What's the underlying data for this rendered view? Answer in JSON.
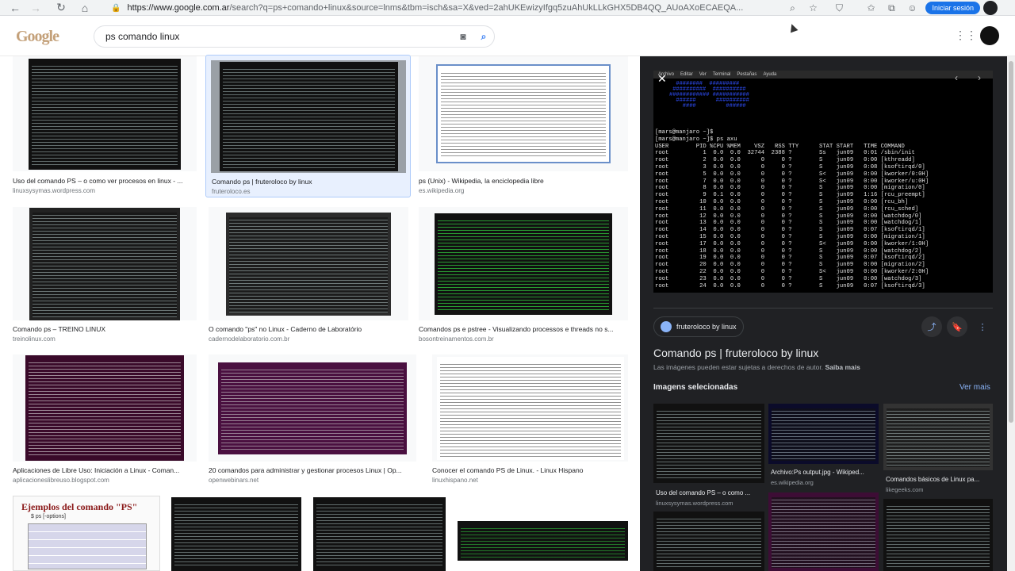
{
  "browser": {
    "url_domain": "https://www.google.com.ar",
    "url_rest": "/search?q=ps+comando+linux&source=lnms&tbm=isch&sa=X&ved=2ahUKEwizyIfgq5zuAhUkLLkGHX5DB4QQ_AUoAXoECAEQA...",
    "signin": "Iniciar sesión",
    "back": "←",
    "forward": "→",
    "reload": "↻",
    "home": "⌂",
    "lock": "🔒"
  },
  "header": {
    "query": "ps comando linux",
    "logo": "Google",
    "apps_icon": "⋮⋮⋮"
  },
  "results": [
    {
      "caption": "Uso del comando PS – o como ver procesos en linux - ...",
      "source": "linuxsysymas.wordpress.com"
    },
    {
      "caption": "Comando ps | fruteroloco by linux",
      "source": "fruteroloco.es"
    },
    {
      "caption": "ps (Unix) - Wikipedia, la enciclopedia libre",
      "source": "es.wikipedia.org"
    },
    {
      "caption": "Comando ps – TREINO LINUX",
      "source": "treinolinux.com"
    },
    {
      "caption": "O comando \"ps\" no Linux - Caderno de Laboratório",
      "source": "cadernodelaboratorio.com.br"
    },
    {
      "caption": "Comandos ps e pstree - Visualizando processos e threads no s...",
      "source": "bosontreinamentos.com.br"
    },
    {
      "caption": "Aplicaciones de Libre Uso: Iniciación a Linux - Coman...",
      "source": "aplicacioneslibreuso.blogspot.com"
    },
    {
      "caption": "20 comandos para administrar y gestionar procesos Linux | Op...",
      "source": "openwebinars.net"
    },
    {
      "caption": "Conocer el comando PS de Linux. - Linux Hispano",
      "source": "linuxhispano.net"
    }
  ],
  "bottom_row": {
    "card_title": "Ejemplos del comando \"PS\"",
    "card_sub": "$ ps [-options]"
  },
  "panel": {
    "menu": [
      "Archivo",
      "Editar",
      "Ver",
      "Terminal",
      "Pestañas",
      "Ayuda"
    ],
    "terminal_text": "[mars@manjaro ~]$\n[mars@manjaro ~]$ ps axu\nUSER        PID %CPU %MEM    VSZ   RSS TTY      STAT START   TIME COMMAND\nroot          1  0.0  0.0  32744  2388 ?        Ss   jun09   0:01 /sbin/init\nroot          2  0.0  0.0      0     0 ?        S    jun09   0:00 [kthreadd]\nroot          3  0.0  0.0      0     0 ?        S    jun09   0:08 [ksoftirqd/0]\nroot          5  0.0  0.0      0     0 ?        S<   jun09   0:00 [kworker/0:0H]\nroot          7  0.0  0.0      0     0 ?        S<   jun09   0:00 [kworker/u:0H]\nroot          8  0.0  0.0      0     0 ?        S    jun09   0:00 [migration/0]\nroot          9  0.1  0.0      0     0 ?        S    jun09   1:16 [rcu_preempt]\nroot         10  0.0  0.0      0     0 ?        S    jun09   0:00 [rcu_bh]\nroot         11  0.0  0.0      0     0 ?        S    jun09   0:00 [rcu_sched]\nroot         12  0.0  0.0      0     0 ?        S    jun09   0:00 [watchdog/0]\nroot         13  0.0  0.0      0     0 ?        S    jun09   0:00 [watchdog/1]\nroot         14  0.0  0.0      0     0 ?        S    jun09   0:07 [ksoftirqd/1]\nroot         15  0.0  0.0      0     0 ?        S    jun09   0:00 [migration/1]\nroot         17  0.0  0.0      0     0 ?        S<   jun09   0:00 [kworker/1:0H]\nroot         18  0.0  0.0      0     0 ?        S    jun09   0:00 [watchdog/2]\nroot         19  0.0  0.0      0     0 ?        S    jun09   0:07 [ksoftirqd/2]\nroot         20  0.0  0.0      0     0 ?        S    jun09   0:00 [migration/2]\nroot         22  0.0  0.0      0     0 ?        S<   jun09   0:00 [kworker/2:0H]\nroot         23  0.0  0.0      0     0 ?        S    jun09   0:00 [watchdog/3]\nroot         24  0.0  0.0      0     0 ?        S    jun09   0:07 [ksoftirqd/3]",
    "banner": "  ########  #########\n ##########  ##########\n############ ###########\n  ######      ##########\n    ####         ######",
    "source": "fruteroloco by linux",
    "title": "Comando ps | fruteroloco by linux",
    "note": "Las imágenes pueden estar sujetas a derechos de autor.",
    "note_link": "Saiba mais",
    "related_heading": "Imagens selecionadas",
    "ver_mas": "Ver mais",
    "related": [
      {
        "caption": "Uso del comando PS – o como ...",
        "source": "linuxsysymas.wordpress.com"
      },
      {
        "caption": "Archivo:Ps output.jpg - Wikiped...",
        "source": "es.wikipedia.org"
      },
      {
        "caption": "Comandos básicos de Linux pa...",
        "source": "likegeeks.com"
      }
    ],
    "icons": {
      "close": "✕",
      "prev": "‹",
      "next": "›",
      "share": "⤴",
      "save": "🔖",
      "more": "⋮"
    }
  },
  "colors": {
    "accent": "#1a73e8",
    "panel_bg": "#202124",
    "link": "#8ab4f8"
  }
}
